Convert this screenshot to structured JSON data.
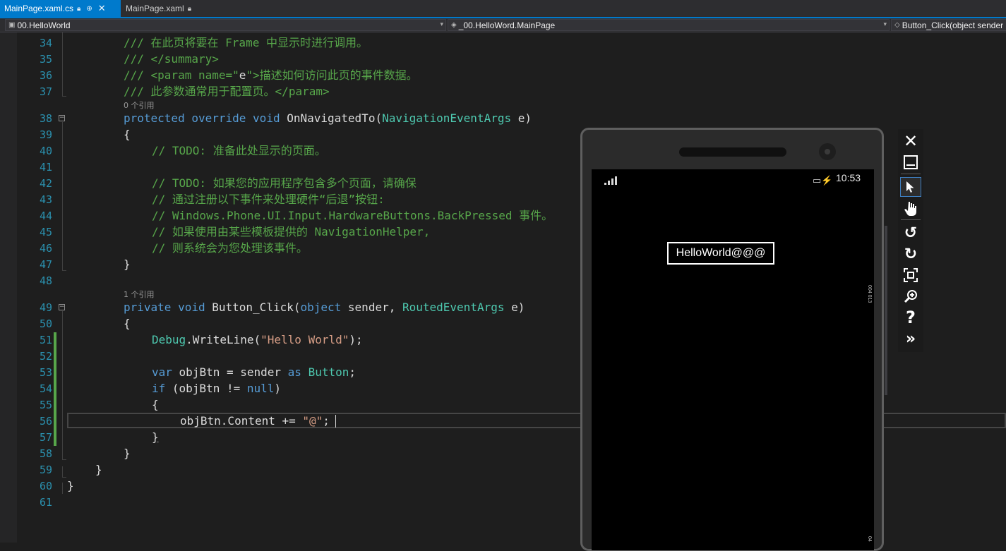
{
  "tabs": [
    {
      "label": "MainPage.xaml.cs",
      "pin_icon": "pin-icon",
      "close_icon": "close-icon",
      "active": true
    },
    {
      "label": "MainPage.xaml",
      "pin_icon": "pin-icon",
      "active": false
    }
  ],
  "navbar": {
    "project": "00.HelloWorld",
    "class": "_00.HelloWord.MainPage",
    "member": "Button_Click(object sender"
  },
  "editor": {
    "line_numbers": [
      "34",
      "35",
      "36",
      "37",
      "38",
      "39",
      "40",
      "41",
      "42",
      "43",
      "44",
      "45",
      "46",
      "47",
      "48",
      "49",
      "50",
      "51",
      "52",
      "53",
      "54",
      "55",
      "56",
      "57",
      "58",
      "59",
      "60",
      "61"
    ],
    "codelens": [
      "0 个引用",
      "1 个引用"
    ],
    "lines": {
      "l34": "/// 在此页将要在 Frame 中显示时进行调用。",
      "l35": "/// </summary>",
      "l36a": "/// <param name=\"",
      "l36b": "e",
      "l36c": "\">描述如何访问此页的事件数据。",
      "l37a": "/// 此参数通常用于配置页。",
      "l37b": "</param>",
      "l38a": "protected",
      "l38b": "override",
      "l38c": "void",
      "l38d": "OnNavigatedTo(",
      "l38e": "NavigationEventArgs",
      "l38f": " e)",
      "l39": "{",
      "l40": "// TODO: 准备此处显示的页面。",
      "l42": "// TODO: 如果您的应用程序包含多个页面，请确保",
      "l43": "// 通过注册以下事件来处理硬件“后退”按钮:",
      "l44": "// Windows.Phone.UI.Input.HardwareButtons.BackPressed 事件。",
      "l45": "// 如果使用由某些模板提供的 NavigationHelper,",
      "l46": "// 则系统会为您处理该事件。",
      "l47": "}",
      "l49a": "private",
      "l49b": "void",
      "l49c": "Button_Click(",
      "l49d": "object",
      "l49e": " sender, ",
      "l49f": "RoutedEventArgs",
      "l49g": " e)",
      "l50": "{",
      "l51a": "Debug",
      "l51b": ".WriteLine(",
      "l51c": "\"Hello World\"",
      "l51d": ");",
      "l53a": "var",
      "l53b": " objBtn = sender ",
      "l53c": "as",
      "l53d": " ",
      "l53e": "Button",
      "l53f": ";",
      "l54a": "if",
      "l54b": " (objBtn != ",
      "l54c": "null",
      "l54d": ")",
      "l55": "{",
      "l56a": "objBtn.Content += ",
      "l56b": "\"@\"",
      "l56c": ";",
      "l57": "}",
      "l58": "}",
      "l59": "}",
      "l60": "}"
    }
  },
  "phone": {
    "clock": "10:53",
    "battery_icon": "battery-charging-icon",
    "signal_icon": "signal-bars-icon",
    "button_label": "HelloWorld@@@",
    "side_text_1": "004 013",
    "side_text_2": "04"
  },
  "emulator_toolbar": [
    "close-icon",
    "minimize-icon",
    "select-icon",
    "hand-icon",
    "rotate-left-icon",
    "rotate-right-icon",
    "fit-screen-icon",
    "zoom-icon",
    "help-icon",
    "more-icon"
  ],
  "colors": {
    "accent": "#007acc",
    "keyword": "#569cd6",
    "type": "#4ec9b0",
    "comment": "#57a64a",
    "string": "#d69d85",
    "line_number": "#2b91af",
    "change_bar": "#57a64a"
  }
}
